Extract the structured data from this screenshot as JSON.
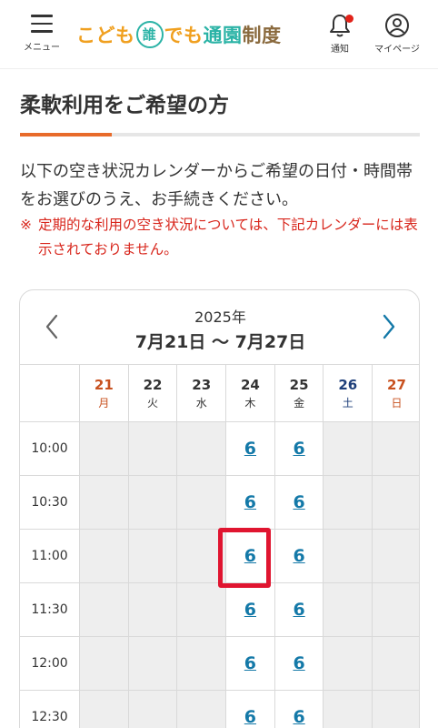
{
  "header": {
    "menu_label": "メニュー",
    "logo": {
      "part1": "こども",
      "part2": "誰",
      "part3": "でも",
      "part4": "通園",
      "part5": "制度"
    },
    "notice_label": "通知",
    "mypage_label": "マイページ"
  },
  "page": {
    "title": "柔軟利用をご希望の方",
    "progress_fraction": 0.23,
    "intro": "以下の空き状況カレンダーからご希望の日付・時間帯をお選びのうえ、お手続きください。",
    "note_mark": "※",
    "note": "定期的な利用の空き状況については、下記カレンダーには表示されておりません。"
  },
  "calendar": {
    "year": "2025年",
    "range": "7月21日 〜 7月27日",
    "days": [
      {
        "num": "21",
        "wd": "月",
        "type": "mon"
      },
      {
        "num": "22",
        "wd": "火",
        "type": ""
      },
      {
        "num": "23",
        "wd": "水",
        "type": ""
      },
      {
        "num": "24",
        "wd": "木",
        "type": ""
      },
      {
        "num": "25",
        "wd": "金",
        "type": ""
      },
      {
        "num": "26",
        "wd": "土",
        "type": "sat"
      },
      {
        "num": "27",
        "wd": "日",
        "type": "sun"
      }
    ],
    "rows": [
      {
        "time": "10:00",
        "cells": [
          "",
          "",
          "",
          "6",
          "6",
          "",
          ""
        ]
      },
      {
        "time": "10:30",
        "cells": [
          "",
          "",
          "",
          "6",
          "6",
          "",
          ""
        ]
      },
      {
        "time": "11:00",
        "cells": [
          "",
          "",
          "",
          "6",
          "6",
          "",
          ""
        ]
      },
      {
        "time": "11:30",
        "cells": [
          "",
          "",
          "",
          "6",
          "6",
          "",
          ""
        ]
      },
      {
        "time": "12:00",
        "cells": [
          "",
          "",
          "",
          "6",
          "6",
          "",
          ""
        ]
      },
      {
        "time": "12:30",
        "cells": [
          "",
          "",
          "",
          "6",
          "6",
          "",
          ""
        ]
      }
    ]
  },
  "colors": {
    "accent": "#e86b2a",
    "note_red": "#d8261c",
    "link_blue": "#1479a8",
    "highlight_red": "#e01530"
  }
}
